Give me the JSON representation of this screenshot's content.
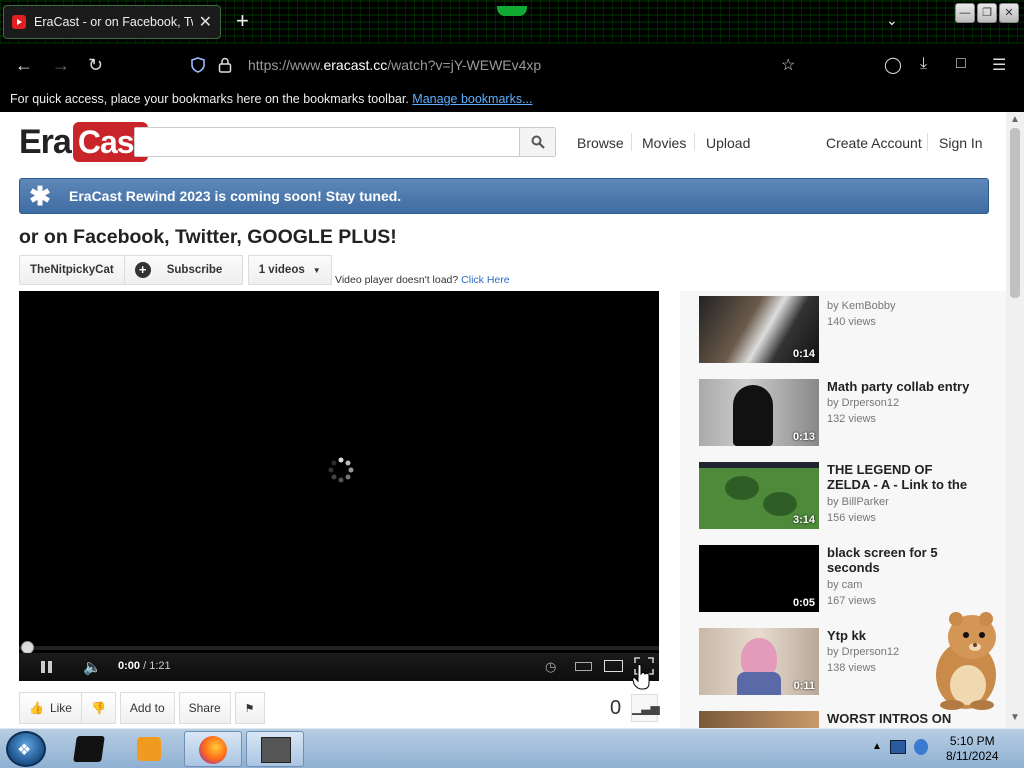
{
  "browser": {
    "tab_title": "EraCast - or on Facebook, Twitt",
    "url_prefix": "https://www.",
    "url_host": "eracast.cc",
    "url_path": "/watch?v=jY-WEWEv4xp",
    "bookmark_text": "For quick access, place your bookmarks here on the bookmarks toolbar.",
    "bookmark_link": "Manage bookmarks..."
  },
  "site": {
    "logo_era": "Era",
    "logo_cast": "Cast",
    "search_placeholder": "",
    "nav": {
      "browse": "Browse",
      "movies": "Movies",
      "upload": "Upload",
      "create_account": "Create Account",
      "sign_in": "Sign In"
    },
    "banner": "EraCast Rewind 2023 is coming soon! Stay tuned."
  },
  "video": {
    "title": "or on Facebook, Twitter, GOOGLE PLUS!",
    "channel": "TheNitpickyCat",
    "subscribe": "Subscribe",
    "videos_count": "1 videos",
    "player_note": "Video player doesn't load?",
    "player_note_link": "Click Here",
    "time_current": "0:00",
    "time_total": "1:21",
    "actions": {
      "like": "Like",
      "add_to": "Add to",
      "share": "Share"
    },
    "view_count": "0"
  },
  "related": [
    {
      "title": "",
      "by": "by KemBobby",
      "views": "140 views",
      "duration": "0:14"
    },
    {
      "title": "Math party collab entry",
      "by": "by Drperson12",
      "views": "132 views",
      "duration": "0:13"
    },
    {
      "title": "THE LEGEND OF ZELDA - A - Link to the",
      "by": "by BillParker",
      "views": "156 views",
      "duration": "3:14"
    },
    {
      "title": "black screen for 5 seconds",
      "by": "by cam",
      "views": "167 views",
      "duration": "0:05"
    },
    {
      "title": "Ytp kk",
      "by": "by Drperson12",
      "views": "138 views",
      "duration": "0:11"
    },
    {
      "title": "WORST INTROS ON",
      "by": "",
      "views": "",
      "duration": ""
    }
  ],
  "taskbar": {
    "time": "5:10 PM",
    "date": "8/11/2024"
  }
}
